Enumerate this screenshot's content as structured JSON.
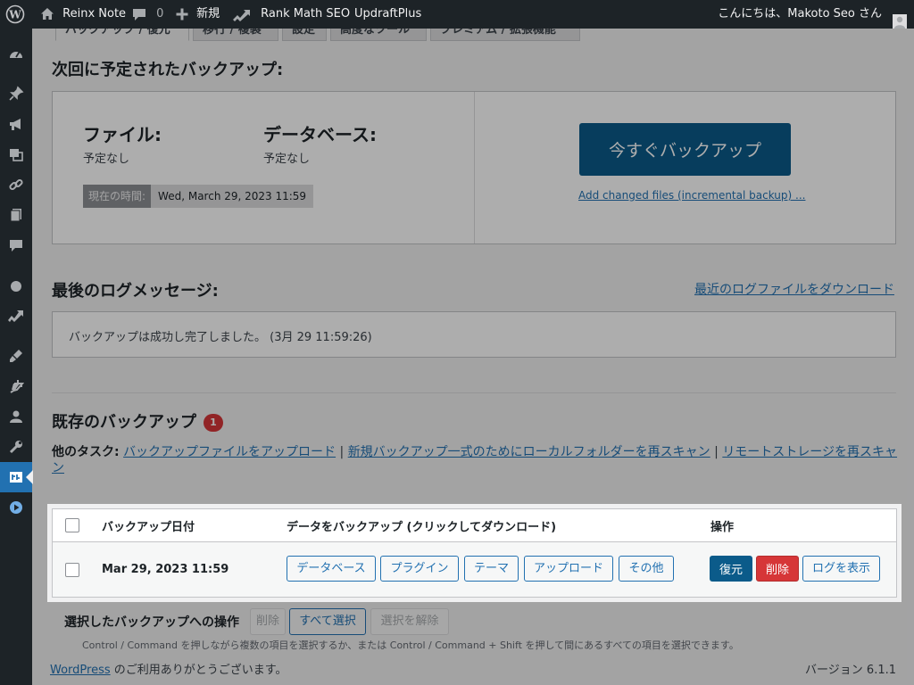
{
  "admin_bar": {
    "site_name": "Reinx Note",
    "comments_count": "0",
    "new_label": "新規",
    "rank_math_label": "Rank Math SEO",
    "updraft_label": "UpdraftPlus",
    "greeting": "こんにちは、Makoto Seo さん"
  },
  "tabs": [
    "バックアップ / 復元",
    "移行 / 複製",
    "設定",
    "高度なツール",
    "プレミアム / 拡張機能"
  ],
  "next_backup": {
    "heading": "次回に予定されたバックアップ:",
    "files_label": "ファイル:",
    "files_value": "予定なし",
    "database_label": "データベース:",
    "database_value": "予定なし",
    "current_time_label": "現在の時間:",
    "current_time_value": "Wed, March 29, 2023 11:59",
    "backup_now_label": "今すぐバックアップ",
    "incremental_link": "Add changed files (incremental backup) ..."
  },
  "last_log": {
    "heading": "最後のログメッセージ:",
    "download_link": "最近のログファイルをダウンロード",
    "message": "バックアップは成功し完了しました。 (3月 29 11:59:26)"
  },
  "existing": {
    "heading": "既存のバックアップ",
    "count": "1",
    "other_tasks_label": "他のタスク:",
    "task_upload": "バックアップファイルをアップロード",
    "task_rescan_local": "新規バックアップ一式のためにローカルフォルダーを再スキャン",
    "task_rescan_remote_line1": "リモートストレージを再スキャ",
    "task_rescan_remote_line2": "ン",
    "separator": "|"
  },
  "table": {
    "col_date": "バックアップ日付",
    "col_data": "データをバックアップ (クリックしてダウンロード)",
    "col_actions": "操作",
    "row": {
      "date": "Mar 29, 2023 11:59",
      "data_buttons": [
        "データベース",
        "プラグイン",
        "テーマ",
        "アップロード",
        "その他"
      ],
      "restore": "復元",
      "delete": "削除",
      "view_log": "ログを表示"
    }
  },
  "bulk": {
    "label": "選択したバックアップへの操作",
    "delete": "削除",
    "select_all": "すべて選択",
    "deselect": "選択を解除",
    "hint": "Control / Command を押しながら複数の項目を選択するか、または Control / Command + Shift を押して間にあるすべての項目を選択できます。"
  },
  "footer": {
    "wp_link": "WordPress",
    "thanks": " のご利用ありがとうございます。",
    "version": "バージョン 6.1.1"
  },
  "colors": {
    "accent": "#2271b1",
    "primary_button": "#0b5b8a",
    "danger": "#d63638",
    "admin_bar": "#1d2327"
  }
}
